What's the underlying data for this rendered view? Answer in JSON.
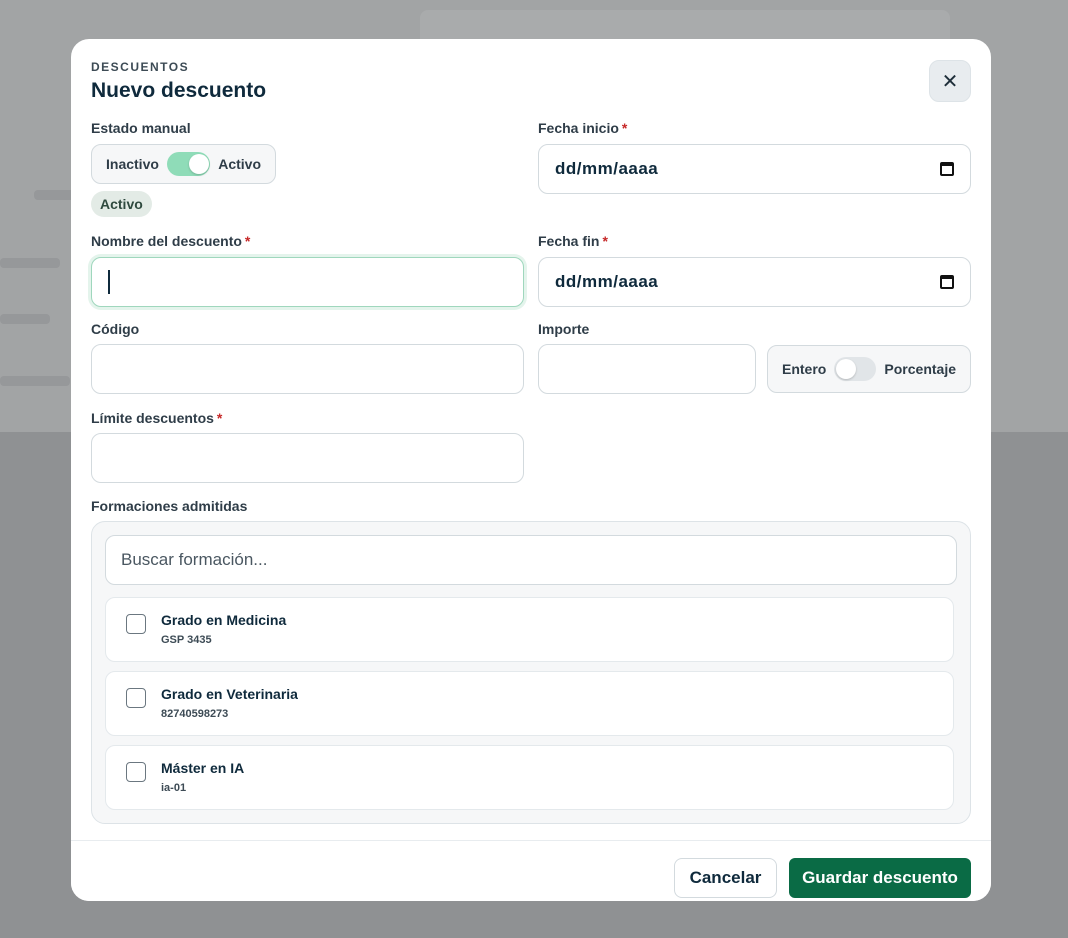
{
  "modal": {
    "eyebrow": "DESCUENTOS",
    "title": "Nuevo descuento",
    "close_icon": "close-icon"
  },
  "estado": {
    "label": "Estado manual",
    "off_label": "Inactivo",
    "on_label": "Activo",
    "checked": true,
    "badge": "Activo"
  },
  "fecha_inicio": {
    "label": "Fecha inicio",
    "required": "*",
    "value": "dd/mm/aaaa",
    "icon": "calendar-icon"
  },
  "fecha_fin": {
    "label": "Fecha fin",
    "required": "*",
    "value": "dd/mm/aaaa",
    "icon": "calendar-icon"
  },
  "nombre": {
    "label": "Nombre del descuento",
    "required": "*",
    "value": ""
  },
  "codigo": {
    "label": "Código",
    "value": ""
  },
  "importe": {
    "label": "Importe",
    "value": "",
    "mode_off_label": "Entero",
    "mode_on_label": "Porcentaje",
    "percentage": false
  },
  "limite": {
    "label": "Límite descuentos",
    "required": "*",
    "value": ""
  },
  "formaciones": {
    "label": "Formaciones admitidas",
    "search_placeholder": "Buscar formación...",
    "items": [
      {
        "name": "Grado en Medicina",
        "code": "GSP 3435",
        "checked": false
      },
      {
        "name": "Grado en Veterinaria",
        "code": "82740598273",
        "checked": false
      },
      {
        "name": "Máster en IA",
        "code": "ia-01",
        "checked": false
      }
    ]
  },
  "footer": {
    "cancel_label": "Cancelar",
    "save_label": "Guardar descuento"
  },
  "colors": {
    "primary": "#0a6b45",
    "toggle_on": "#8fdcb8",
    "required": "#c62828",
    "text": "#0f2a3c"
  }
}
